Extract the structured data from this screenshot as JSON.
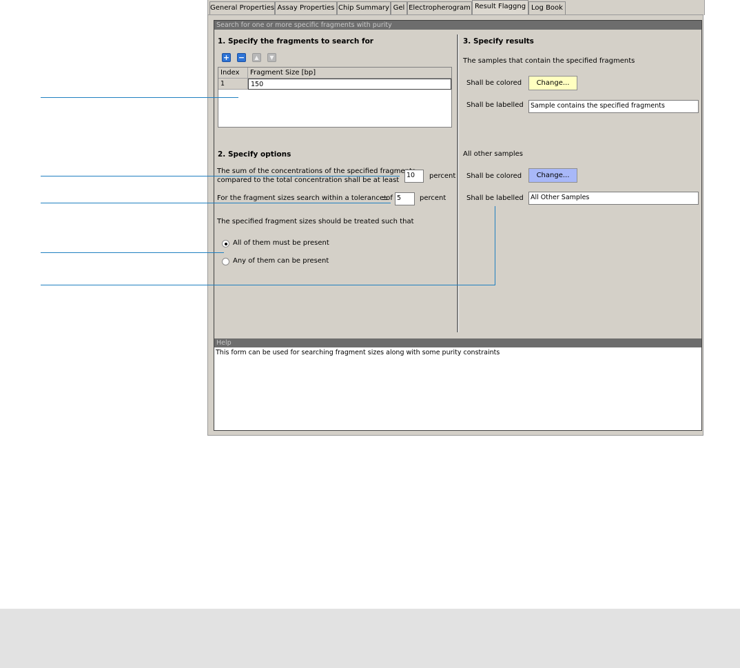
{
  "tabs": [
    "General Properties",
    "Assay Properties",
    "Chip Summary",
    "Gel",
    "Electropherogram",
    "Result Flaggng",
    "Log Book"
  ],
  "active_tab": "Result Flaggng",
  "form": {
    "header": "Search for one or more specific fragments with purity",
    "section1_title": "1. Specify the fragments to search for",
    "toolbar": {
      "add_icon": "plus-icon",
      "remove_icon": "minus-icon",
      "up_icon": "arrow-up-icon",
      "down_icon": "arrow-down-icon"
    },
    "table": {
      "columns": [
        "Index",
        "Fragment Size [bp]"
      ],
      "rows": [
        {
          "index": "1",
          "size": "150"
        }
      ]
    },
    "section2_title": "2. Specify options",
    "concentration_line1": "The sum of the concentrations of the specified fragments",
    "concentration_line2": "compared to the total concentration shall be at least",
    "concentration_value": "10",
    "percent_label": "percent",
    "tolerance_label": "For the fragment sizes search within a tolerance of",
    "tolerance_symbol": "±",
    "tolerance_value": "5",
    "treatment_label": "The specified fragment sizes should be treated such that",
    "radio_all": "All of them must be present",
    "radio_any": "Any of them can be present",
    "section3_title": "3. Specify results",
    "contain_label": "The samples that contain the specified fragments",
    "colored_label": "Shall be colored",
    "labelled_label": "Shall be labelled",
    "change_label": "Change...",
    "contain_color": "#ffffc0",
    "contain_text": "Sample contains the specified fragments",
    "other_label": "All other samples",
    "other_color": "#a8b8f8",
    "other_text": "All Other Samples"
  },
  "help": {
    "header": "Help",
    "text": "This form can be used for searching fragment sizes along with some purity constraints"
  },
  "callout_color": "#1e7fc0"
}
